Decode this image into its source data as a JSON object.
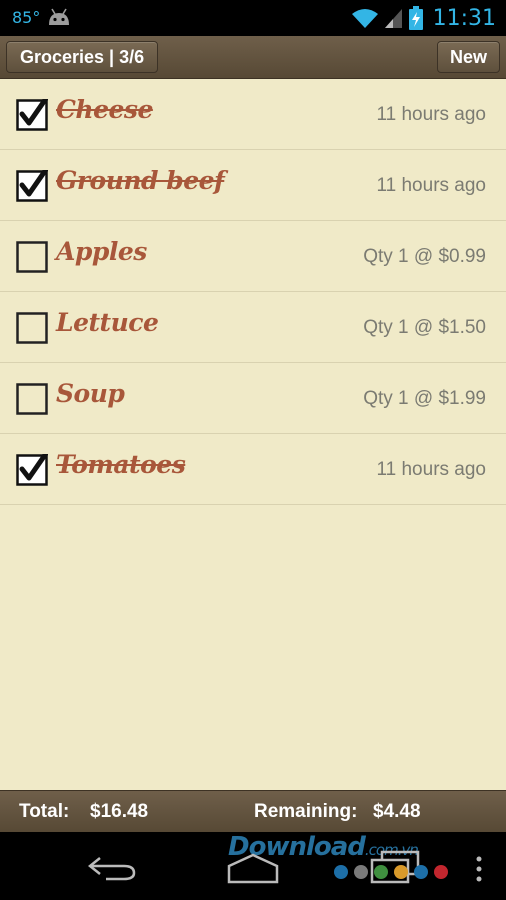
{
  "status_bar": {
    "temperature": "85°",
    "time": "11:31",
    "accent_color": "#33b5e5"
  },
  "action_bar": {
    "title": "Groceries | 3/6",
    "new_label": "New"
  },
  "items": [
    {
      "name": "Cheese",
      "checked": true,
      "meta": "11 hours ago"
    },
    {
      "name": "Ground beef",
      "checked": true,
      "meta": "11 hours ago"
    },
    {
      "name": "Apples",
      "checked": false,
      "meta": "Qty 1 @ $0.99"
    },
    {
      "name": "Lettuce",
      "checked": false,
      "meta": "Qty 1 @ $1.50"
    },
    {
      "name": "Soup",
      "checked": false,
      "meta": "Qty 1 @ $1.99"
    },
    {
      "name": "Tomatoes",
      "checked": true,
      "meta": "11 hours ago"
    }
  ],
  "footer": {
    "total_label": "Total:",
    "total_value": "$16.48",
    "remaining_label": "Remaining:",
    "remaining_value": "$4.48"
  },
  "watermark": {
    "text": "Download",
    "suffix": ".com.vn"
  },
  "colors": {
    "item_text": "#a8573a",
    "list_background": "#f0eac8",
    "bar_background": "#5e503c",
    "dots": [
      "#1d6fa8",
      "#7a7a7a",
      "#3f8f3f",
      "#d99a2b",
      "#1d6fa8",
      "#c2262e"
    ]
  }
}
